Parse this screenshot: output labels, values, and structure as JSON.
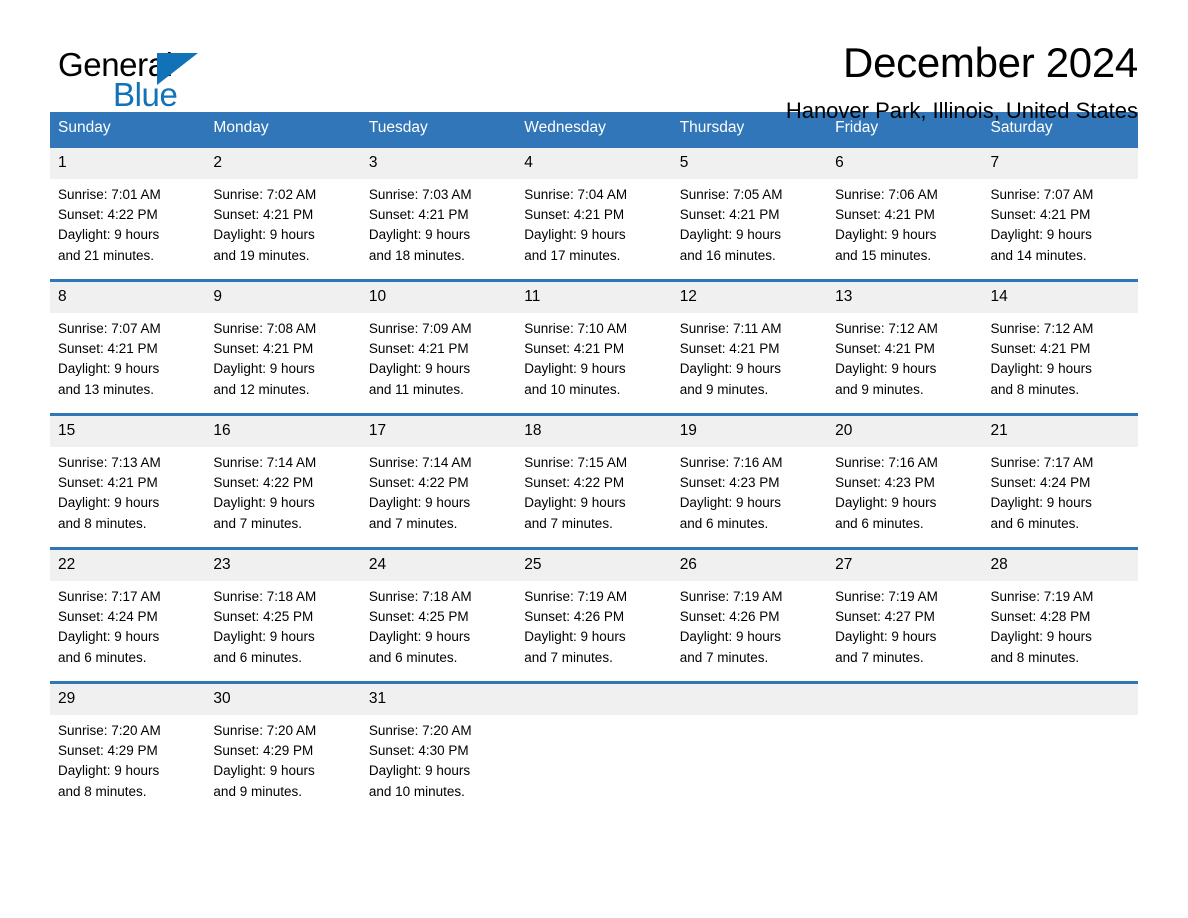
{
  "brand": {
    "name_part1": "General",
    "name_part2": "Blue",
    "accent_color": "#1272b8",
    "logo_icon": "triangle-icon"
  },
  "header": {
    "month_title": "December 2024",
    "location": "Hanover Park, Illinois, United States"
  },
  "theme": {
    "header_blue": "#3176b8",
    "daynum_gray": "#f0f0f0",
    "text_black": "#000000"
  },
  "weekday_headers": [
    "Sunday",
    "Monday",
    "Tuesday",
    "Wednesday",
    "Thursday",
    "Friday",
    "Saturday"
  ],
  "weeks": [
    [
      {
        "day": "1",
        "sunrise": "Sunrise: 7:01 AM",
        "sunset": "Sunset: 4:22 PM",
        "daylight_l1": "Daylight: 9 hours",
        "daylight_l2": "and 21 minutes."
      },
      {
        "day": "2",
        "sunrise": "Sunrise: 7:02 AM",
        "sunset": "Sunset: 4:21 PM",
        "daylight_l1": "Daylight: 9 hours",
        "daylight_l2": "and 19 minutes."
      },
      {
        "day": "3",
        "sunrise": "Sunrise: 7:03 AM",
        "sunset": "Sunset: 4:21 PM",
        "daylight_l1": "Daylight: 9 hours",
        "daylight_l2": "and 18 minutes."
      },
      {
        "day": "4",
        "sunrise": "Sunrise: 7:04 AM",
        "sunset": "Sunset: 4:21 PM",
        "daylight_l1": "Daylight: 9 hours",
        "daylight_l2": "and 17 minutes."
      },
      {
        "day": "5",
        "sunrise": "Sunrise: 7:05 AM",
        "sunset": "Sunset: 4:21 PM",
        "daylight_l1": "Daylight: 9 hours",
        "daylight_l2": "and 16 minutes."
      },
      {
        "day": "6",
        "sunrise": "Sunrise: 7:06 AM",
        "sunset": "Sunset: 4:21 PM",
        "daylight_l1": "Daylight: 9 hours",
        "daylight_l2": "and 15 minutes."
      },
      {
        "day": "7",
        "sunrise": "Sunrise: 7:07 AM",
        "sunset": "Sunset: 4:21 PM",
        "daylight_l1": "Daylight: 9 hours",
        "daylight_l2": "and 14 minutes."
      }
    ],
    [
      {
        "day": "8",
        "sunrise": "Sunrise: 7:07 AM",
        "sunset": "Sunset: 4:21 PM",
        "daylight_l1": "Daylight: 9 hours",
        "daylight_l2": "and 13 minutes."
      },
      {
        "day": "9",
        "sunrise": "Sunrise: 7:08 AM",
        "sunset": "Sunset: 4:21 PM",
        "daylight_l1": "Daylight: 9 hours",
        "daylight_l2": "and 12 minutes."
      },
      {
        "day": "10",
        "sunrise": "Sunrise: 7:09 AM",
        "sunset": "Sunset: 4:21 PM",
        "daylight_l1": "Daylight: 9 hours",
        "daylight_l2": "and 11 minutes."
      },
      {
        "day": "11",
        "sunrise": "Sunrise: 7:10 AM",
        "sunset": "Sunset: 4:21 PM",
        "daylight_l1": "Daylight: 9 hours",
        "daylight_l2": "and 10 minutes."
      },
      {
        "day": "12",
        "sunrise": "Sunrise: 7:11 AM",
        "sunset": "Sunset: 4:21 PM",
        "daylight_l1": "Daylight: 9 hours",
        "daylight_l2": "and 9 minutes."
      },
      {
        "day": "13",
        "sunrise": "Sunrise: 7:12 AM",
        "sunset": "Sunset: 4:21 PM",
        "daylight_l1": "Daylight: 9 hours",
        "daylight_l2": "and 9 minutes."
      },
      {
        "day": "14",
        "sunrise": "Sunrise: 7:12 AM",
        "sunset": "Sunset: 4:21 PM",
        "daylight_l1": "Daylight: 9 hours",
        "daylight_l2": "and 8 minutes."
      }
    ],
    [
      {
        "day": "15",
        "sunrise": "Sunrise: 7:13 AM",
        "sunset": "Sunset: 4:21 PM",
        "daylight_l1": "Daylight: 9 hours",
        "daylight_l2": "and 8 minutes."
      },
      {
        "day": "16",
        "sunrise": "Sunrise: 7:14 AM",
        "sunset": "Sunset: 4:22 PM",
        "daylight_l1": "Daylight: 9 hours",
        "daylight_l2": "and 7 minutes."
      },
      {
        "day": "17",
        "sunrise": "Sunrise: 7:14 AM",
        "sunset": "Sunset: 4:22 PM",
        "daylight_l1": "Daylight: 9 hours",
        "daylight_l2": "and 7 minutes."
      },
      {
        "day": "18",
        "sunrise": "Sunrise: 7:15 AM",
        "sunset": "Sunset: 4:22 PM",
        "daylight_l1": "Daylight: 9 hours",
        "daylight_l2": "and 7 minutes."
      },
      {
        "day": "19",
        "sunrise": "Sunrise: 7:16 AM",
        "sunset": "Sunset: 4:23 PM",
        "daylight_l1": "Daylight: 9 hours",
        "daylight_l2": "and 6 minutes."
      },
      {
        "day": "20",
        "sunrise": "Sunrise: 7:16 AM",
        "sunset": "Sunset: 4:23 PM",
        "daylight_l1": "Daylight: 9 hours",
        "daylight_l2": "and 6 minutes."
      },
      {
        "day": "21",
        "sunrise": "Sunrise: 7:17 AM",
        "sunset": "Sunset: 4:24 PM",
        "daylight_l1": "Daylight: 9 hours",
        "daylight_l2": "and 6 minutes."
      }
    ],
    [
      {
        "day": "22",
        "sunrise": "Sunrise: 7:17 AM",
        "sunset": "Sunset: 4:24 PM",
        "daylight_l1": "Daylight: 9 hours",
        "daylight_l2": "and 6 minutes."
      },
      {
        "day": "23",
        "sunrise": "Sunrise: 7:18 AM",
        "sunset": "Sunset: 4:25 PM",
        "daylight_l1": "Daylight: 9 hours",
        "daylight_l2": "and 6 minutes."
      },
      {
        "day": "24",
        "sunrise": "Sunrise: 7:18 AM",
        "sunset": "Sunset: 4:25 PM",
        "daylight_l1": "Daylight: 9 hours",
        "daylight_l2": "and 6 minutes."
      },
      {
        "day": "25",
        "sunrise": "Sunrise: 7:19 AM",
        "sunset": "Sunset: 4:26 PM",
        "daylight_l1": "Daylight: 9 hours",
        "daylight_l2": "and 7 minutes."
      },
      {
        "day": "26",
        "sunrise": "Sunrise: 7:19 AM",
        "sunset": "Sunset: 4:26 PM",
        "daylight_l1": "Daylight: 9 hours",
        "daylight_l2": "and 7 minutes."
      },
      {
        "day": "27",
        "sunrise": "Sunrise: 7:19 AM",
        "sunset": "Sunset: 4:27 PM",
        "daylight_l1": "Daylight: 9 hours",
        "daylight_l2": "and 7 minutes."
      },
      {
        "day": "28",
        "sunrise": "Sunrise: 7:19 AM",
        "sunset": "Sunset: 4:28 PM",
        "daylight_l1": "Daylight: 9 hours",
        "daylight_l2": "and 8 minutes."
      }
    ],
    [
      {
        "day": "29",
        "sunrise": "Sunrise: 7:20 AM",
        "sunset": "Sunset: 4:29 PM",
        "daylight_l1": "Daylight: 9 hours",
        "daylight_l2": "and 8 minutes."
      },
      {
        "day": "30",
        "sunrise": "Sunrise: 7:20 AM",
        "sunset": "Sunset: 4:29 PM",
        "daylight_l1": "Daylight: 9 hours",
        "daylight_l2": "and 9 minutes."
      },
      {
        "day": "31",
        "sunrise": "Sunrise: 7:20 AM",
        "sunset": "Sunset: 4:30 PM",
        "daylight_l1": "Daylight: 9 hours",
        "daylight_l2": "and 10 minutes."
      },
      {
        "day": "",
        "sunrise": "",
        "sunset": "",
        "daylight_l1": "",
        "daylight_l2": ""
      },
      {
        "day": "",
        "sunrise": "",
        "sunset": "",
        "daylight_l1": "",
        "daylight_l2": ""
      },
      {
        "day": "",
        "sunrise": "",
        "sunset": "",
        "daylight_l1": "",
        "daylight_l2": ""
      },
      {
        "day": "",
        "sunrise": "",
        "sunset": "",
        "daylight_l1": "",
        "daylight_l2": ""
      }
    ]
  ]
}
